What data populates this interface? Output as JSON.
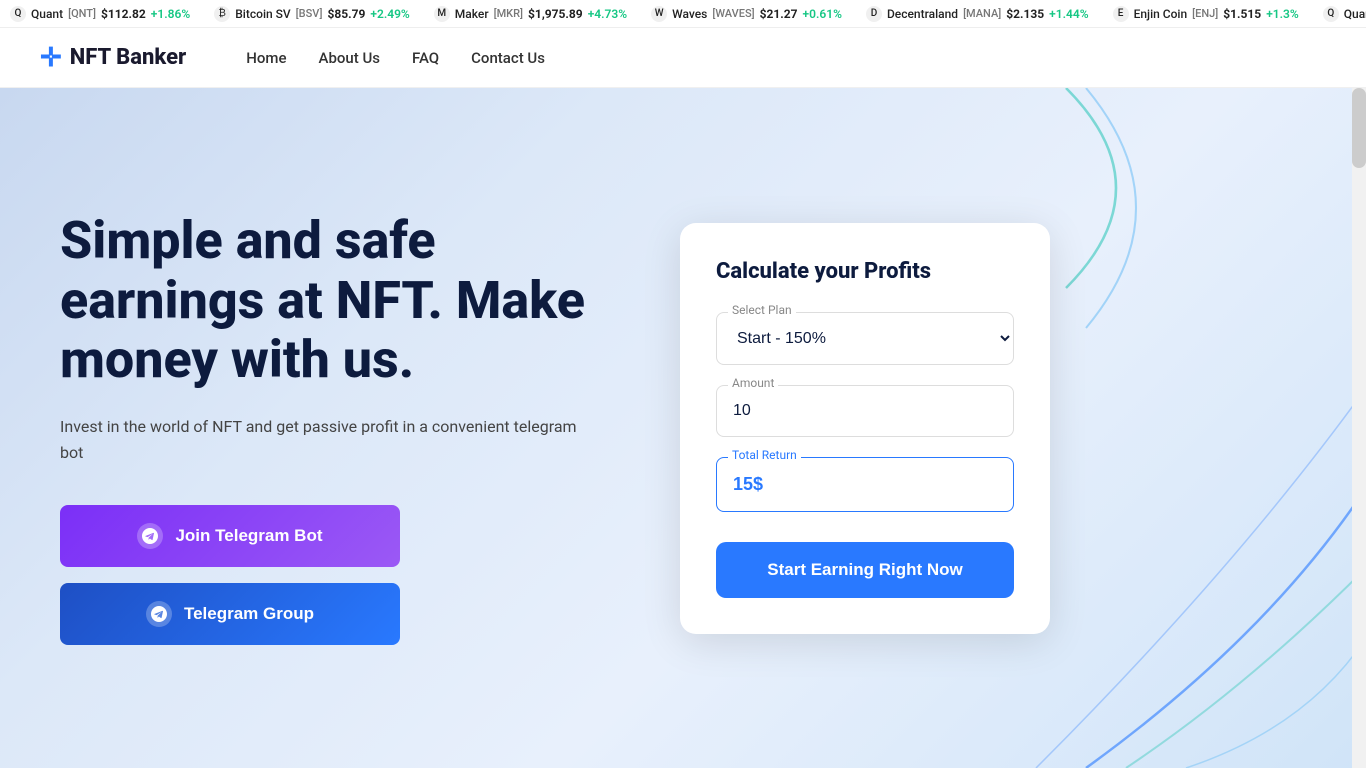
{
  "ticker": {
    "items": [
      {
        "id": "qnt",
        "name": "Quant",
        "symbol": "QNT",
        "price": "$112.82",
        "change": "+1.86%",
        "positive": true,
        "icon": "Q"
      },
      {
        "id": "bsv",
        "name": "Bitcoin SV",
        "symbol": "BSV",
        "price": "$85.79",
        "change": "+2.49%",
        "positive": true,
        "icon": "₿"
      },
      {
        "id": "mkr",
        "name": "Maker",
        "symbol": "MKR",
        "price": "$1,975.89",
        "change": "+4.73%",
        "positive": true,
        "icon": "M"
      },
      {
        "id": "waves",
        "name": "Waves",
        "symbol": "WAVES",
        "price": "$21.27",
        "change": "+0.61%",
        "positive": true,
        "icon": "W"
      },
      {
        "id": "mana",
        "name": "Decentraland",
        "symbol": "MANA",
        "price": "$2.135",
        "change": "+1.44%",
        "positive": true,
        "icon": "D"
      },
      {
        "id": "enj",
        "name": "Enjin Coin",
        "symbol": "ENJ",
        "price": "$1.515",
        "change": "+1.3%",
        "positive": true,
        "icon": "E"
      }
    ]
  },
  "navbar": {
    "logo_text": "NFT Banker",
    "links": [
      "Home",
      "About Us",
      "FAQ",
      "Contact Us"
    ]
  },
  "hero": {
    "title": "Simple and safe earnings at NFT. Make money with us.",
    "subtitle": "Invest in the world of NFT and get passive profit in a convenient telegram bot",
    "btn_bot": "Join Telegram Bot",
    "btn_group": "Telegram Group"
  },
  "calculator": {
    "title": "Calculate your Profits",
    "plan_label": "Select Plan",
    "plan_value": "Start - 150%",
    "amount_label": "Amount",
    "amount_value": "10",
    "return_label": "Total Return",
    "return_value": "15$",
    "btn_label": "Start Earning Right Now"
  }
}
